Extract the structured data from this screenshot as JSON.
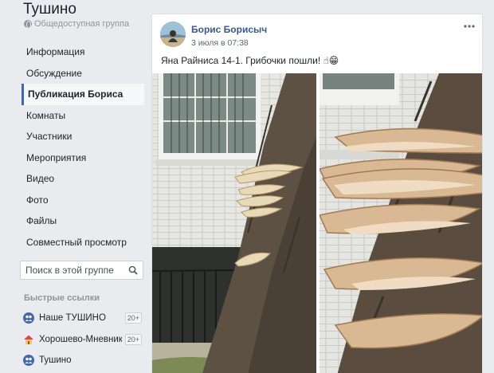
{
  "group": {
    "name": "Тушино",
    "type_label": "Общедоступная группа"
  },
  "nav": {
    "items": [
      {
        "label": "Информация"
      },
      {
        "label": "Обсуждение"
      },
      {
        "label": "Публикация Бориса"
      },
      {
        "label": "Комнаты"
      },
      {
        "label": "Участники"
      },
      {
        "label": "Мероприятия"
      },
      {
        "label": "Видео"
      },
      {
        "label": "Фото"
      },
      {
        "label": "Файлы"
      },
      {
        "label": "Совместный просмотр"
      }
    ],
    "active_index": 2
  },
  "search": {
    "placeholder": "Поиск в этой группе"
  },
  "quick_links": {
    "title": "Быстрые ссылки",
    "items": [
      {
        "label": "Наше ТУШИНО",
        "badge": "20+",
        "icon": "group-icon"
      },
      {
        "label": "Хорошево-Мневники",
        "badge": "20+",
        "icon": "house-icon"
      },
      {
        "label": "Тушино",
        "badge": "",
        "icon": "group-icon"
      }
    ]
  },
  "post": {
    "author": "Борис Борисыч",
    "time": "3 июля в 07:38",
    "text": "Яна Райниса 14-1. Грибочки пошли! ☝😁",
    "photos": [
      "mushrooms-on-tree-wide",
      "mushrooms-on-tree-closeup"
    ]
  },
  "colors": {
    "background": "#e9ebee",
    "link": "#385898",
    "accent": "#4267b2",
    "secondary_text": "#90949c"
  }
}
